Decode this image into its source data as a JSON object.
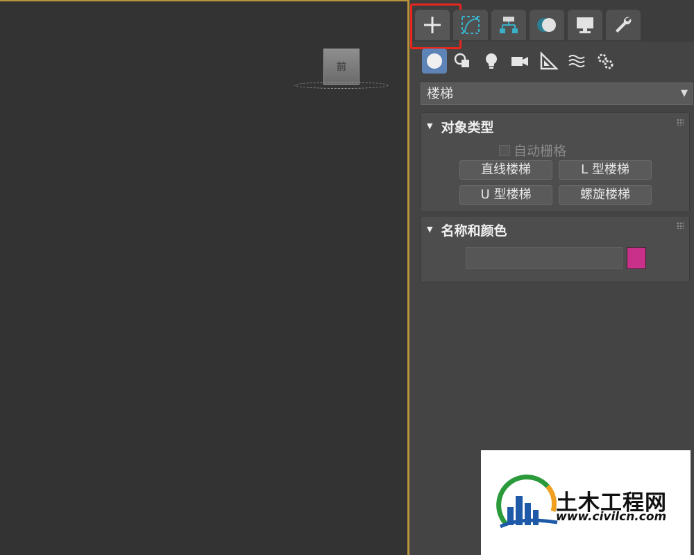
{
  "viewport": {
    "viewcube_label": "前"
  },
  "command_panel": {
    "tabs": [
      {
        "icon": "plus-icon"
      },
      {
        "icon": "modify-curve-icon"
      },
      {
        "icon": "hierarchy-icon"
      },
      {
        "icon": "motion-icon"
      },
      {
        "icon": "display-monitor-icon"
      },
      {
        "icon": "wrench-icon"
      }
    ],
    "subtabs": [
      {
        "icon": "geometry-sphere-icon"
      },
      {
        "icon": "shapes-icon"
      },
      {
        "icon": "lights-bulb-icon"
      },
      {
        "icon": "camera-icon"
      },
      {
        "icon": "helpers-ruler-icon"
      },
      {
        "icon": "spacewarps-icon"
      },
      {
        "icon": "systems-gears-icon"
      }
    ],
    "category_dropdown": {
      "value": "楼梯"
    },
    "object_type": {
      "title": "对象类型",
      "autogrid_label": "自动栅格",
      "buttons": [
        "直线楼梯",
        "L 型楼梯",
        "U 型楼梯",
        "螺旋楼梯"
      ]
    },
    "name_and_color": {
      "title": "名称和颜色",
      "name_value": "",
      "color": "#c8308a"
    }
  },
  "watermark": {
    "title": "土木工程网",
    "url": "www.civilcn.com"
  },
  "colors": {
    "active_tab_outline": "#e8261d",
    "viewport_border": "#b8953a",
    "active_subtab": "#5e83b6"
  }
}
